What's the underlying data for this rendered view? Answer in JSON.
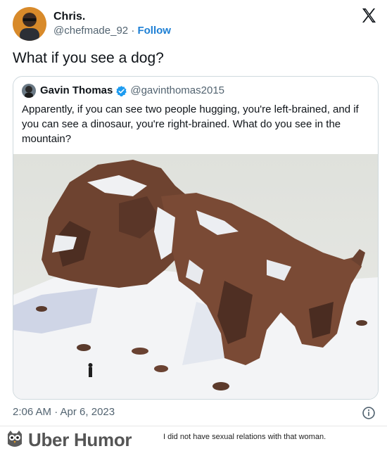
{
  "tweet": {
    "author_name": "Chris.",
    "author_handle": "@chefmade_92",
    "separator": "·",
    "follow_label": "Follow",
    "text": "What if you see a dog?",
    "timestamp": "2:06 AM · Apr 6, 2023"
  },
  "quote": {
    "author_name": "Gavin Thomas",
    "author_handle": "@gavinthomas2015",
    "text": "Apparently, if you can see two people hugging, you're left-brained, and if you can see a dinosaur, you're right-brained. What do you see in the mountain?"
  },
  "icons": {
    "logo": "x-logo-icon",
    "verified": "verified-badge-icon",
    "info": "info-icon",
    "footer_logo": "owl-icon"
  },
  "footer": {
    "brand": "Uber Humor",
    "caption": "I did not have sexual relations with that woman."
  },
  "colors": {
    "follow": "#1d7fd4",
    "verified": "#1d9bf0",
    "muted_text": "#536471"
  }
}
